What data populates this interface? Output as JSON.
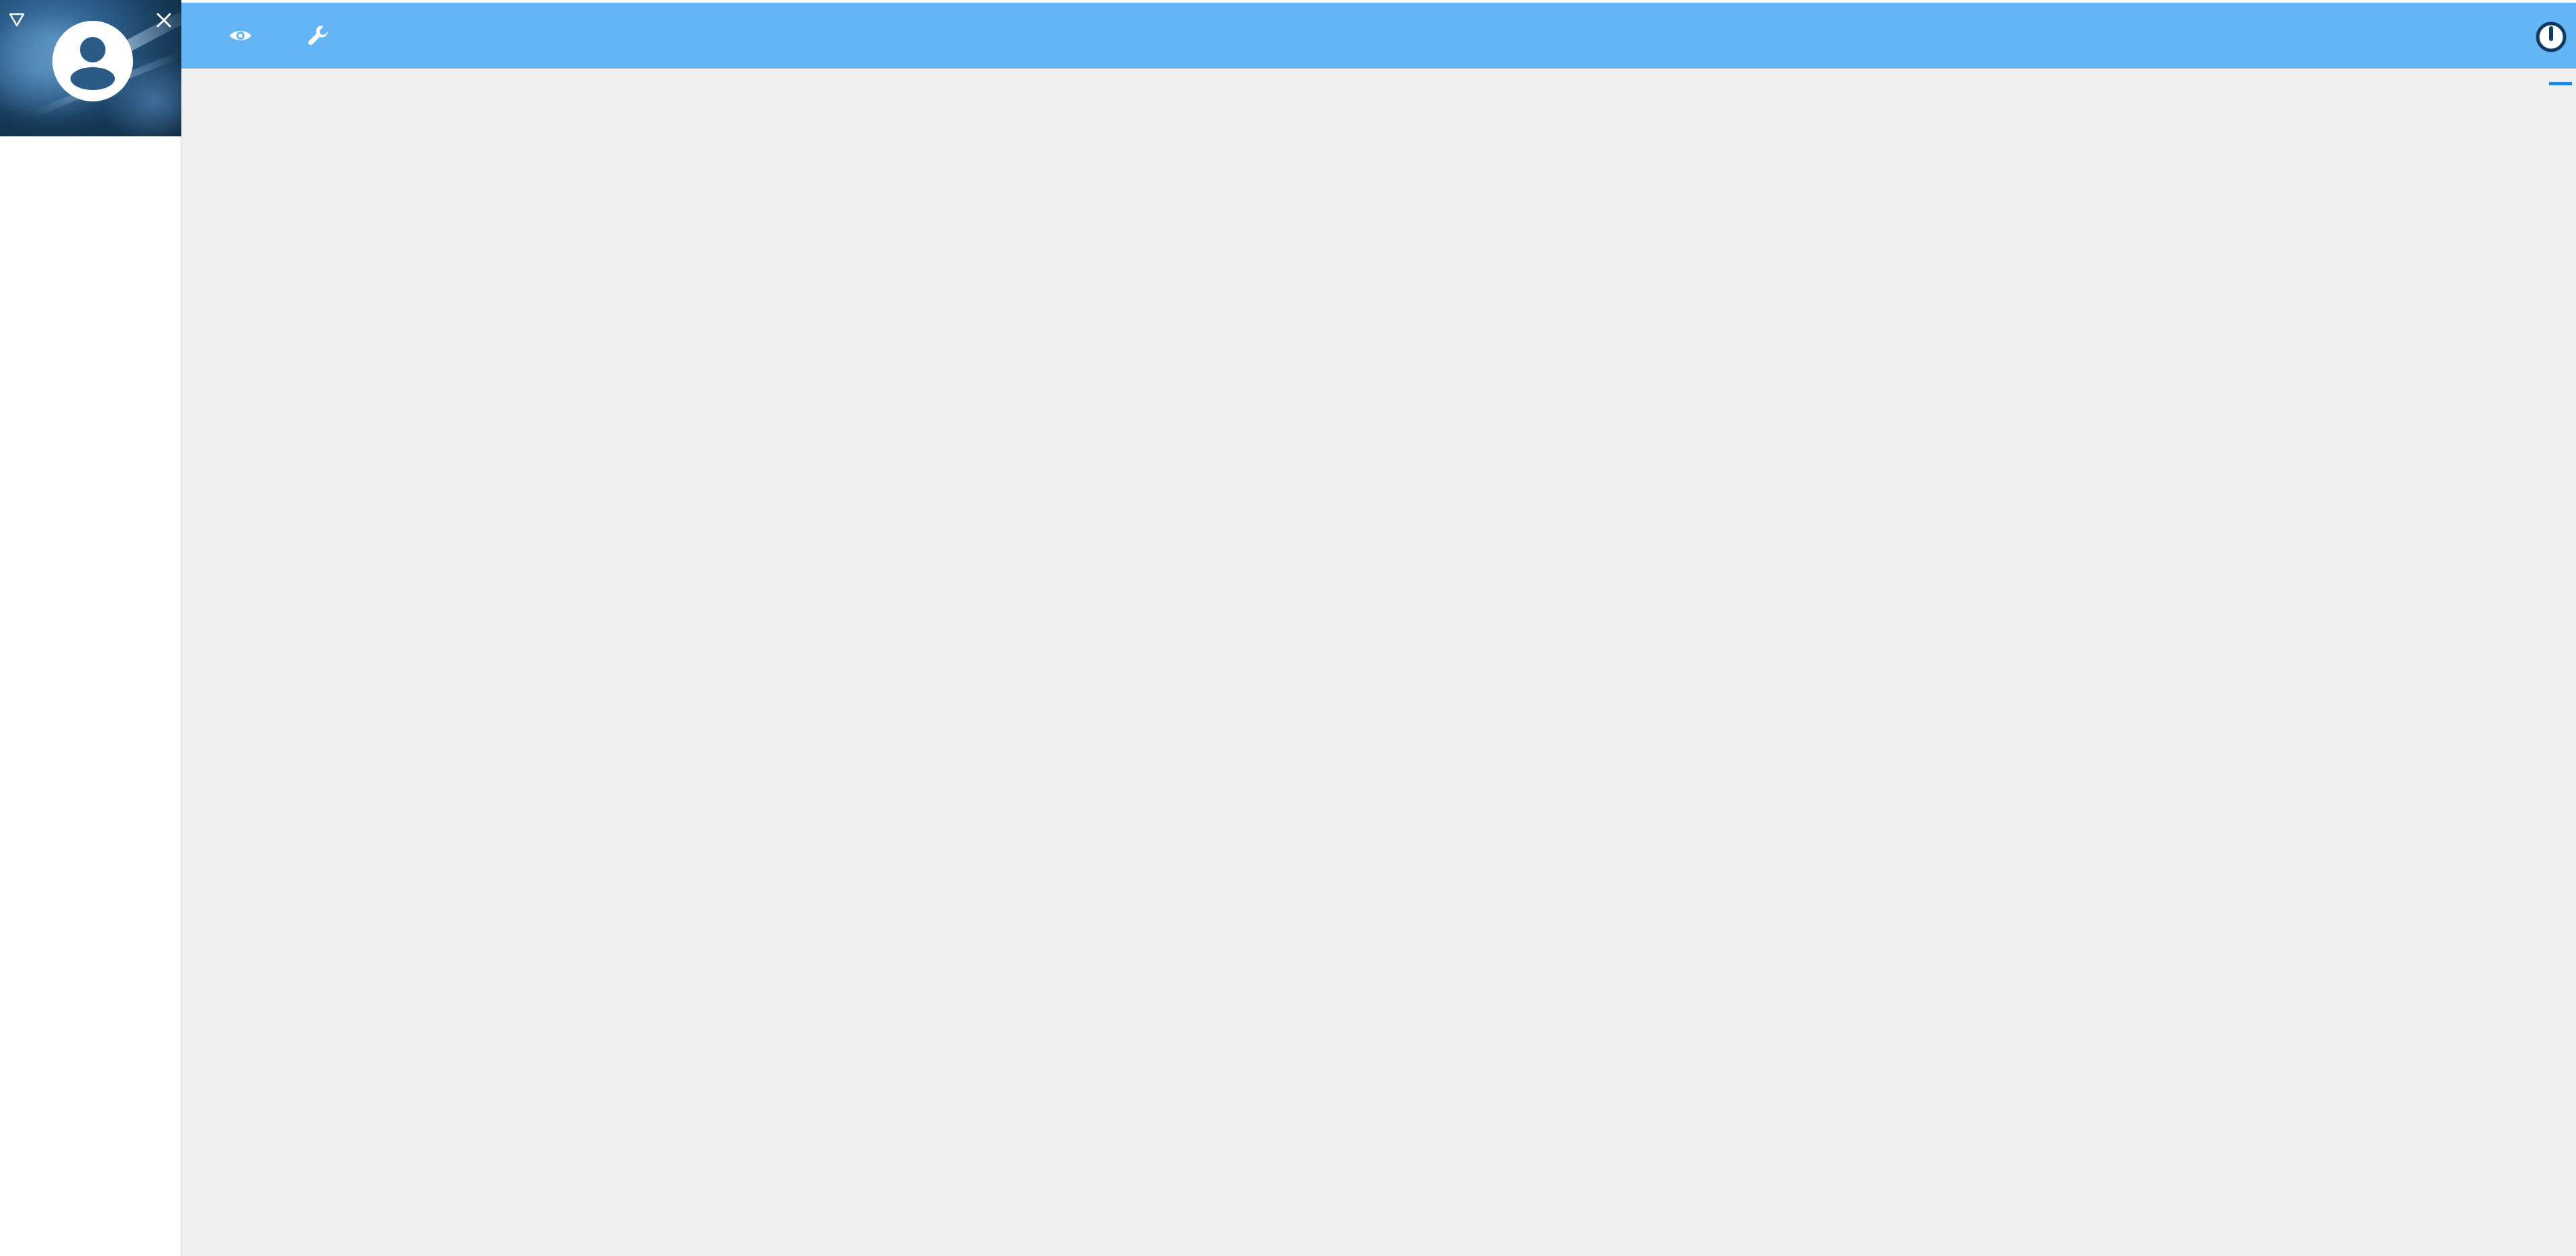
{
  "app": {
    "name": "",
    "colors": {
      "toolbar": "#64b5f6",
      "content_background": "#eeeeef",
      "sidebar_background": "#ffffff",
      "accent": "#1e88e5",
      "power_icon": "#0d3b66"
    }
  },
  "sidebar": {
    "profile": {
      "avatar_icon": "account-circle-icon",
      "dropdown_icon": "triangle-down-outline-icon",
      "close_icon": "close-icon"
    }
  },
  "toolbar": {
    "buttons": [
      {
        "icon": "eye-icon"
      },
      {
        "icon": "wrench-icon"
      }
    ],
    "power_icon": "power-icon"
  },
  "content": {
    "minimize_icon": "minimize-icon"
  }
}
